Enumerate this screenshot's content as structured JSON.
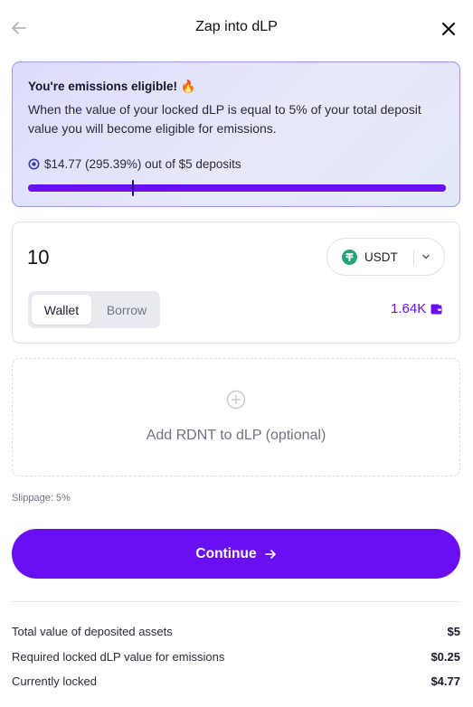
{
  "header": {
    "title": "Zap into dLP"
  },
  "eligibility": {
    "title": "You're emissions eligible!",
    "emoji": "🔥",
    "description": "When the value of your locked dLP is equal to 5% of your total deposit value you will become eligible for emissions.",
    "locked_summary": "$14.77 (295.39%) out of $5 deposits",
    "progress_fraction": 1.0,
    "required_marker_fraction": 0.25,
    "accent_color": "#6a0ff2"
  },
  "input": {
    "amount": "10",
    "token": "USDT",
    "token_icon": "tether-icon",
    "tabs": [
      "Wallet",
      "Borrow"
    ],
    "active_tab": "Wallet",
    "balance": "1.64K"
  },
  "add_rdnt": {
    "label": "Add RDNT to dLP (optional)"
  },
  "slippage": "Slippage: 5%",
  "continue_label": "Continue",
  "summary": [
    {
      "label": "Total value of deposited assets",
      "value": "$5"
    },
    {
      "label": "Required locked dLP value for emissions",
      "value": "$0.25"
    },
    {
      "label": "Currently locked",
      "value": "$4.77"
    }
  ]
}
